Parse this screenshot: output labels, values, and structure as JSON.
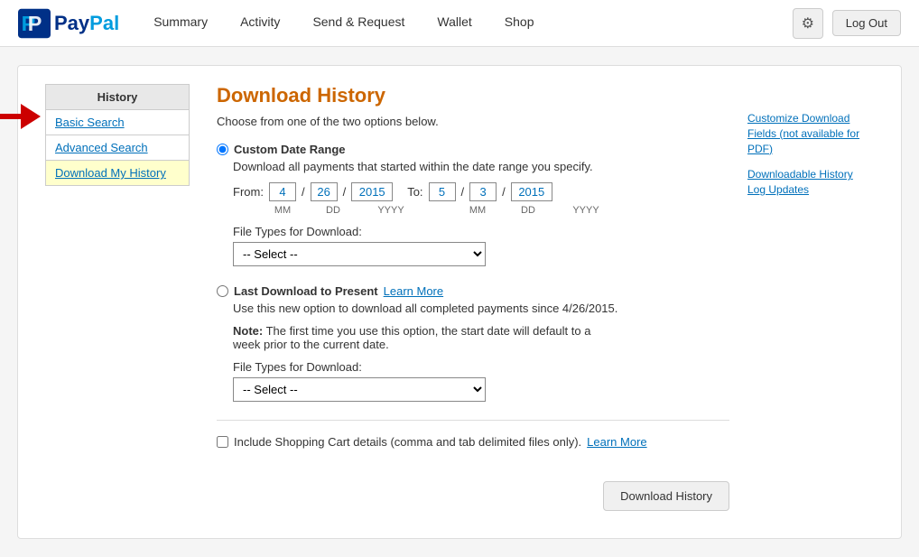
{
  "nav": {
    "logo_text": "PayPal",
    "links": [
      {
        "label": "Summary",
        "id": "summary"
      },
      {
        "label": "Activity",
        "id": "activity"
      },
      {
        "label": "Send & Request",
        "id": "send-request"
      },
      {
        "label": "Wallet",
        "id": "wallet"
      },
      {
        "label": "Shop",
        "id": "shop"
      }
    ],
    "gear_icon": "⚙",
    "logout_label": "Log Out"
  },
  "sidebar": {
    "title": "History",
    "links": [
      {
        "label": "Basic Search",
        "id": "basic-search",
        "active": false
      },
      {
        "label": "Advanced Search",
        "id": "advanced-search",
        "active": false
      },
      {
        "label": "Download My History",
        "id": "download-history",
        "active": true
      }
    ]
  },
  "page": {
    "title": "Download History",
    "subtitle": "Choose from one of the two options below.",
    "option1": {
      "label": "Custom Date Range",
      "description": "Download all payments that started within the date range you specify.",
      "from_label": "From:",
      "from_mm": "4",
      "from_dd": "26",
      "from_yyyy": "2015",
      "to_label": "To:",
      "to_mm": "5",
      "to_dd": "3",
      "to_yyyy": "2015",
      "hint_mm": "MM",
      "hint_dd": "DD",
      "hint_yyyy": "YYYY",
      "file_types_label": "File Types for Download:",
      "select_placeholder": "-- Select --"
    },
    "option2": {
      "label": "Last Download to Present",
      "learn_more_label": "Learn More",
      "description": "Use this new option to download all completed payments since 4/26/2015.",
      "note_bold": "Note:",
      "note_text": " The first time you use this option, the start date will default to a week prior to the current date.",
      "file_types_label": "File Types for Download:",
      "select_placeholder": "-- Select --"
    },
    "checkbox": {
      "label": "Include Shopping Cart details (comma and tab delimited files only).",
      "learn_more_label": "Learn More"
    },
    "download_button": "Download History"
  },
  "right_sidebar": {
    "link1": "Customize Download Fields (not available for PDF)",
    "link2": "Downloadable History Log Updates"
  }
}
